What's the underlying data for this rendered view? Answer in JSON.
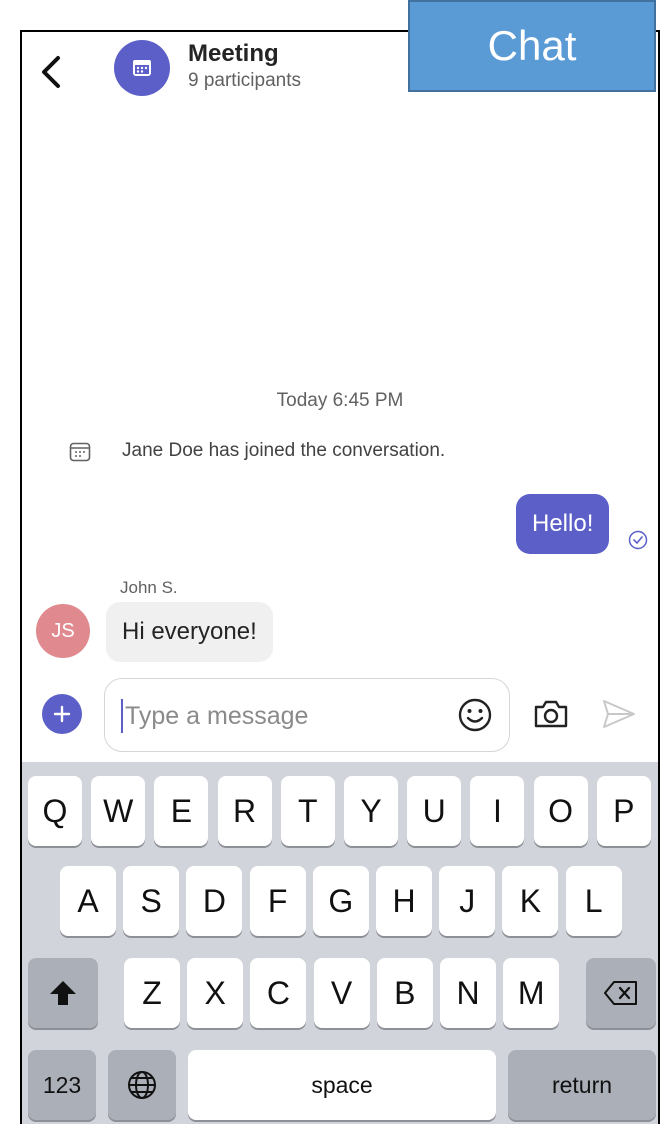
{
  "annotation_label": "Chat",
  "header": {
    "title": "Meeting",
    "subtitle": "9 participants"
  },
  "conversation": {
    "timestamp": "Today 6:45 PM",
    "system_message": "Jane Doe has joined the conversation.",
    "outgoing": {
      "text": "Hello!"
    },
    "incoming": {
      "sender": "John S.",
      "initials": "JS",
      "text": "Hi everyone!"
    }
  },
  "composer": {
    "placeholder": "Type a message"
  },
  "keyboard": {
    "row1": [
      "Q",
      "W",
      "E",
      "R",
      "T",
      "Y",
      "U",
      "I",
      "O",
      "P"
    ],
    "row2": [
      "A",
      "S",
      "D",
      "F",
      "G",
      "H",
      "J",
      "K",
      "L"
    ],
    "row3": [
      "Z",
      "X",
      "C",
      "V",
      "B",
      "N",
      "M"
    ],
    "numbers_label": "123",
    "space_label": "space",
    "return_label": "return"
  },
  "colors": {
    "accent": "#5b5fc7",
    "incoming_bubble": "#f0f0f0",
    "avatar_js": "#e08a8f",
    "label_box": "#5b9bd5"
  },
  "icons": [
    "back-chevron-icon",
    "calendar-icon",
    "read-receipt-check-icon",
    "plus-icon",
    "emoji-icon",
    "camera-icon",
    "send-icon",
    "shift-icon",
    "backspace-icon",
    "globe-icon"
  ]
}
